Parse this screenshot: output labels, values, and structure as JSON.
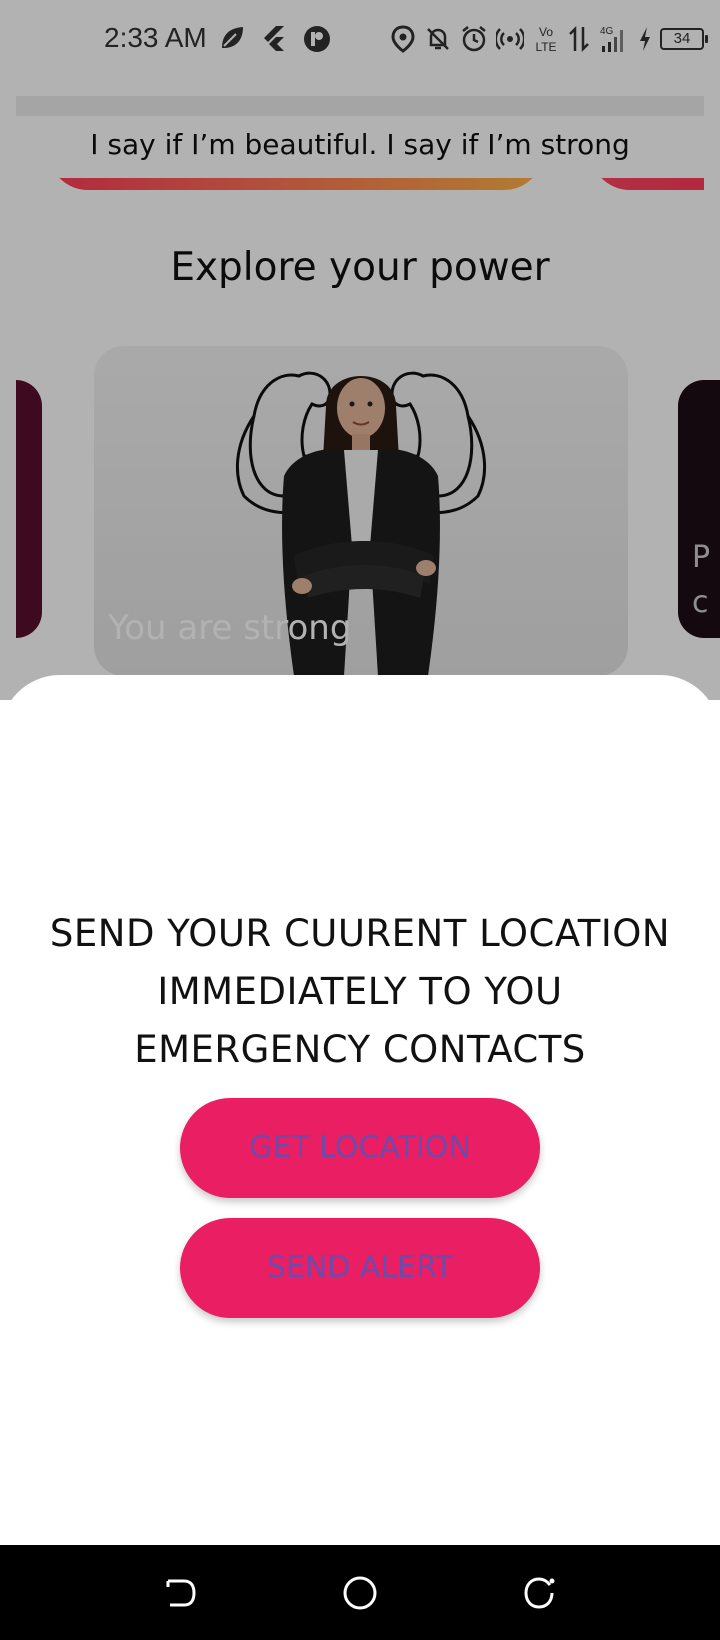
{
  "status_bar": {
    "time": "2:33 AM",
    "battery": "34",
    "app_icons": [
      "leaf-icon",
      "flutter-icon",
      "app-badge-icon"
    ],
    "system_icons": [
      "location-icon",
      "bell-off-icon",
      "alarm-icon",
      "hotspot-icon",
      "volte-icon",
      "data-arrows-icon",
      "signal-4g-icon",
      "charging-icon",
      "battery-icon"
    ],
    "volte_label": "Vo LTE",
    "network_label": "4G"
  },
  "quote": {
    "text": "I say if I’m beautiful. I say if I’m strong"
  },
  "section": {
    "title": "Explore your power"
  },
  "carousel": {
    "cards": [
      {
        "caption": "You are strong",
        "image": "woman-with-flexed-arms-illustration"
      }
    ],
    "right_peek_text": [
      "P",
      "c"
    ]
  },
  "sheet": {
    "message": "SEND YOUR CUURENT LOCATION IMMEDIATELY TO YOU EMERGENCY CONTACTS",
    "get_location_label": "GET LOCATION",
    "send_alert_label": "SEND ALERT"
  },
  "colors": {
    "button_bg": "#ea1e63",
    "button_text": "#6a4cad",
    "sheet_bg": "#ffffff",
    "nav_bg": "#000000"
  },
  "nav_bar": {
    "buttons": [
      "back-icon",
      "home-icon",
      "recents-icon"
    ]
  }
}
